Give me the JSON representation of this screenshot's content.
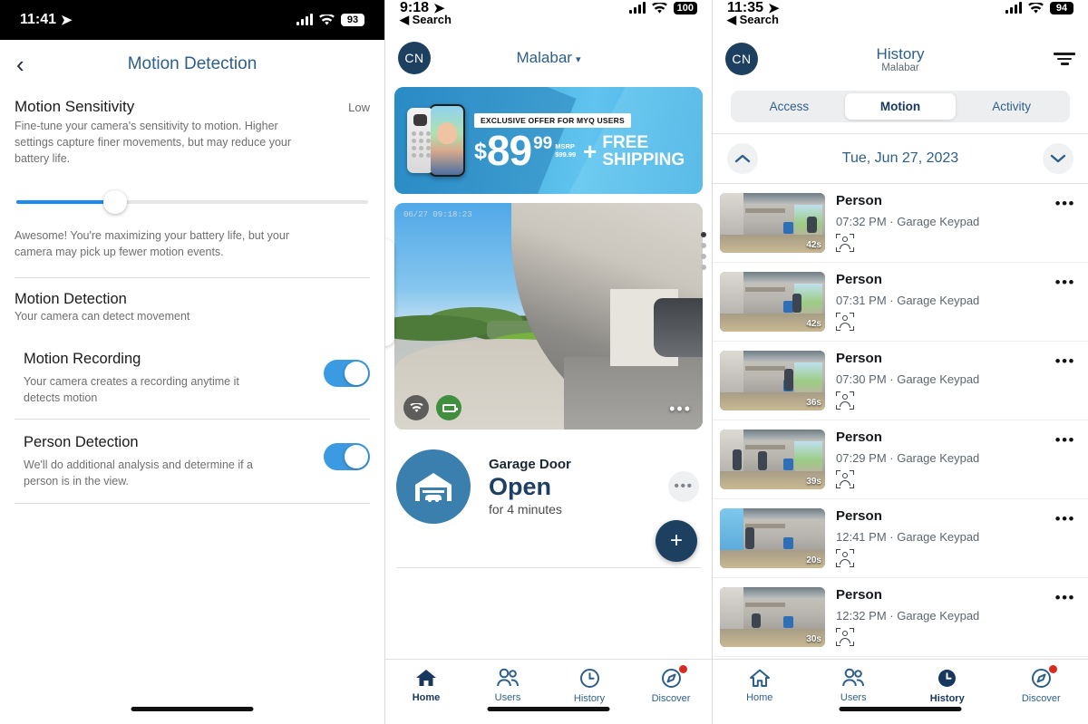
{
  "left": {
    "status": {
      "time": "11:41",
      "battery": "93"
    },
    "header": {
      "back_icon": "chevron-left-icon",
      "title": "Motion Detection"
    },
    "sensitivity": {
      "title": "Motion Sensitivity",
      "value_label": "Low",
      "description": "Fine-tune your camera's sensitivity to motion. Higher settings capture finer movements, but may reduce your battery life.",
      "slider_percent": 28,
      "note": "Awesome! You're maximizing your battery life, but your camera may pick up fewer motion events."
    },
    "detection": {
      "title": "Motion Detection",
      "subtitle": "Your camera can detect movement",
      "rows": [
        {
          "title": "Motion Recording",
          "desc": "Your camera creates a recording anytime it detects motion",
          "enabled": "on"
        },
        {
          "title": "Person Detection",
          "desc": "We'll do additional analysis and determine if a person is in the view.",
          "enabled": "on"
        }
      ]
    }
  },
  "mid": {
    "status": {
      "time": "9:18",
      "back_label": "Search",
      "battery": "100"
    },
    "header": {
      "avatar": "CN",
      "title": "Malabar",
      "caret": "▾"
    },
    "promo": {
      "tag": "EXCLUSIVE OFFER FOR MYQ USERS",
      "currency": "$",
      "price": "89",
      "cents": "99",
      "msrp_label": "MSRP",
      "msrp_value": "$99.99",
      "plus": "+",
      "free_line1": "FREE",
      "free_line2": "SHIPPING",
      "dots": 4,
      "active_dot": 0
    },
    "camera": {
      "timestamp": "06/27  09:18:23",
      "wifi_icon": "wifi-icon",
      "battery_icon": "battery-full-icon",
      "more_icon": "more-horizontal-icon"
    },
    "device": {
      "icon": "garage-door-icon",
      "name": "Garage Door",
      "state": "Open",
      "duration": "for 4 minutes",
      "more_icon": "more-horizontal-icon",
      "add_label": "+"
    },
    "tabs": [
      {
        "label": "Home",
        "icon": "home-icon",
        "active": "true",
        "badge": "false"
      },
      {
        "label": "Users",
        "icon": "users-icon",
        "active": "false",
        "badge": "false"
      },
      {
        "label": "History",
        "icon": "clock-icon",
        "active": "false",
        "badge": "false"
      },
      {
        "label": "Discover",
        "icon": "compass-icon",
        "active": "false",
        "badge": "true"
      }
    ]
  },
  "right": {
    "status": {
      "time": "11:35",
      "back_label": "Search",
      "battery": "94"
    },
    "header": {
      "avatar": "CN",
      "title": "History",
      "subtitle": "Malabar",
      "filter_icon": "filter-icon"
    },
    "segments": [
      {
        "label": "Access",
        "active": "false"
      },
      {
        "label": "Motion",
        "active": "true"
      },
      {
        "label": "Activity",
        "active": "false"
      }
    ],
    "date": {
      "prev_icon": "chevron-up-icon",
      "label": "Tue, Jun 27, 2023",
      "next_icon": "chevron-down-icon"
    },
    "events": [
      {
        "title": "Person",
        "time": "07:32 PM",
        "source": "Garage Keypad",
        "duration": "42s",
        "detect_icon": "person-detect-icon",
        "more_icon": "more-horizontal-icon"
      },
      {
        "title": "Person",
        "time": "07:31 PM",
        "source": "Garage Keypad",
        "duration": "42s",
        "detect_icon": "person-detect-icon",
        "more_icon": "more-horizontal-icon"
      },
      {
        "title": "Person",
        "time": "07:30 PM",
        "source": "Garage Keypad",
        "duration": "36s",
        "detect_icon": "person-detect-icon",
        "more_icon": "more-horizontal-icon"
      },
      {
        "title": "Person",
        "time": "07:29 PM",
        "source": "Garage Keypad",
        "duration": "39s",
        "detect_icon": "person-detect-icon",
        "more_icon": "more-horizontal-icon"
      },
      {
        "title": "Person",
        "time": "12:41 PM",
        "source": "Garage Keypad",
        "duration": "20s",
        "detect_icon": "person-detect-icon",
        "more_icon": "more-horizontal-icon"
      },
      {
        "title": "Person",
        "time": "12:32 PM",
        "source": "Garage Keypad",
        "duration": "30s",
        "detect_icon": "person-detect-icon",
        "more_icon": "more-horizontal-icon"
      }
    ],
    "tabs": [
      {
        "label": "Home",
        "icon": "home-icon",
        "active": "false",
        "badge": "false"
      },
      {
        "label": "Users",
        "icon": "users-icon",
        "active": "false",
        "badge": "false"
      },
      {
        "label": "History",
        "icon": "clock-icon",
        "active": "true",
        "badge": "false"
      },
      {
        "label": "Discover",
        "icon": "compass-icon",
        "active": "false",
        "badge": "true"
      }
    ]
  },
  "colors": {
    "accent_blue": "#2e5f8a",
    "toggle_blue": "#3b9ae1",
    "slider_blue": "#1a8cf0",
    "navy": "#1d4060",
    "badge_red": "#d62b1f"
  }
}
